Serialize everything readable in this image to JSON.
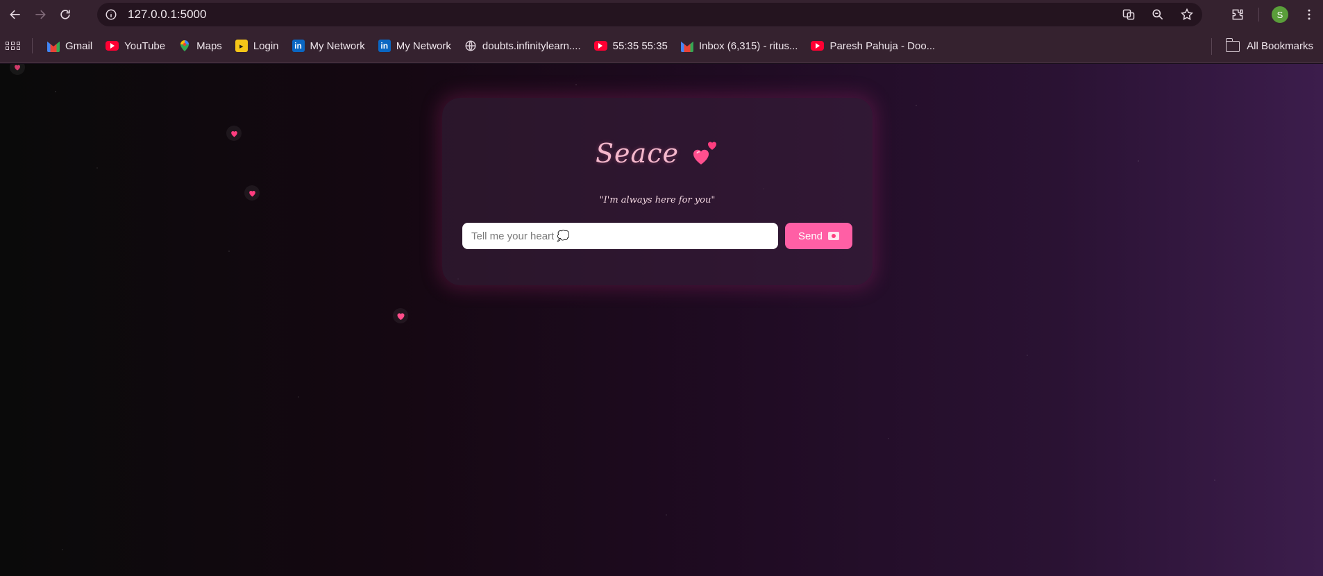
{
  "browser": {
    "url": "127.0.0.1:5000",
    "profile_initial": "S",
    "bookmarks": [
      {
        "label": "Gmail",
        "icon": "gmail-icon"
      },
      {
        "label": "YouTube",
        "icon": "youtube-icon"
      },
      {
        "label": "Maps",
        "icon": "maps-icon"
      },
      {
        "label": "Login",
        "icon": "login-icon"
      },
      {
        "label": "My Network",
        "icon": "linkedin-icon"
      },
      {
        "label": "My Network",
        "icon": "linkedin-icon"
      },
      {
        "label": "doubts.infinitylearn....",
        "icon": "globe-icon"
      },
      {
        "label": "55:35 55:35",
        "icon": "youtube-icon"
      },
      {
        "label": "Inbox (6,315) - ritus...",
        "icon": "gmail-icon"
      },
      {
        "label": "Paresh Pahuja - Doo...",
        "icon": "youtube-icon"
      }
    ],
    "all_bookmarks_label": "All Bookmarks"
  },
  "app": {
    "title": "Seace",
    "tagline": "\"I'm always here for you\"",
    "input_placeholder": "Tell me your heart 💭",
    "send_label": "Send",
    "colors": {
      "accent": "#ff5fa5",
      "title": "#f5b8cc",
      "heart": "#ff3d7f"
    }
  }
}
